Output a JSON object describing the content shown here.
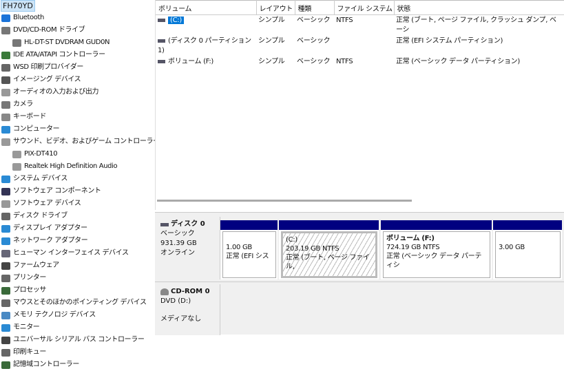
{
  "tree": {
    "root": "FH70YD",
    "items": [
      {
        "label": "Bluetooth",
        "icon": "bluetooth-icon",
        "color": "#1a73d9",
        "indent": 0
      },
      {
        "label": "DVD/CD-ROM ドライブ",
        "icon": "dvd-drive-icon",
        "color": "#777",
        "indent": 0
      },
      {
        "label": "HL-DT-ST DVDRAM GUD0N",
        "icon": "dvd-drive-icon",
        "color": "#777",
        "indent": 1
      },
      {
        "label": "IDE ATA/ATAPI コントローラー",
        "icon": "ide-controller-icon",
        "color": "#3a7a3a",
        "indent": 0
      },
      {
        "label": "WSD 印刷プロバイダー",
        "icon": "printer-icon",
        "color": "#666",
        "indent": 0
      },
      {
        "label": "イメージング デバイス",
        "icon": "imaging-device-icon",
        "color": "#555",
        "indent": 0
      },
      {
        "label": "オーディオの入力および出力",
        "icon": "speaker-icon",
        "color": "#999",
        "indent": 0
      },
      {
        "label": "カメラ",
        "icon": "camera-icon",
        "color": "#777",
        "indent": 0
      },
      {
        "label": "キーボード",
        "icon": "keyboard-icon",
        "color": "#888",
        "indent": 0
      },
      {
        "label": "コンピューター",
        "icon": "computer-icon",
        "color": "#2a8ad4",
        "indent": 0
      },
      {
        "label": "サウンド、ビデオ、およびゲーム コントローラー",
        "icon": "speaker-icon",
        "color": "#999",
        "indent": 0
      },
      {
        "label": "PIX-DT410",
        "icon": "speaker-icon",
        "color": "#999",
        "indent": 1
      },
      {
        "label": "Realtek High Definition Audio",
        "icon": "speaker-icon",
        "color": "#999",
        "indent": 1
      },
      {
        "label": "システム デバイス",
        "icon": "system-device-icon",
        "color": "#2a8ad4",
        "indent": 0
      },
      {
        "label": "ソフトウェア コンポーネント",
        "icon": "software-component-icon",
        "color": "#335",
        "indent": 0
      },
      {
        "label": "ソフトウェア デバイス",
        "icon": "software-device-icon",
        "color": "#999",
        "indent": 0
      },
      {
        "label": "ディスク ドライブ",
        "icon": "disk-drive-icon",
        "color": "#666",
        "indent": 0
      },
      {
        "label": "ディスプレイ アダプター",
        "icon": "display-adapter-icon",
        "color": "#2a8ad4",
        "indent": 0
      },
      {
        "label": "ネットワーク アダプター",
        "icon": "network-adapter-icon",
        "color": "#2a8ad4",
        "indent": 0
      },
      {
        "label": "ヒューマン インターフェイス デバイス",
        "icon": "hid-icon",
        "color": "#667",
        "indent": 0
      },
      {
        "label": "ファームウェア",
        "icon": "firmware-icon",
        "color": "#444",
        "indent": 0
      },
      {
        "label": "プリンター",
        "icon": "printer-icon",
        "color": "#666",
        "indent": 0
      },
      {
        "label": "プロセッサ",
        "icon": "processor-icon",
        "color": "#3a6a3a",
        "indent": 0
      },
      {
        "label": "マウスとそのほかのポインティング デバイス",
        "icon": "mouse-icon",
        "color": "#666",
        "indent": 0
      },
      {
        "label": "メモリ テクノロジ デバイス",
        "icon": "memory-device-icon",
        "color": "#4a8ac4",
        "indent": 0
      },
      {
        "label": "モニター",
        "icon": "monitor-icon",
        "color": "#2a8ad4",
        "indent": 0
      },
      {
        "label": "ユニバーサル シリアル バス コントローラー",
        "icon": "usb-icon",
        "color": "#444",
        "indent": 0
      },
      {
        "label": "印刷キュー",
        "icon": "print-queue-icon",
        "color": "#666",
        "indent": 0
      },
      {
        "label": "記憶域コントローラー",
        "icon": "storage-controller-icon",
        "color": "#3a6a3a",
        "indent": 0
      }
    ]
  },
  "volumes": {
    "headers": [
      "ボリューム",
      "レイアウト",
      "種類",
      "ファイル システム",
      "状態"
    ],
    "rows": [
      [
        "(C:)",
        "シンプル",
        "ベーシック",
        "NTFS",
        "正常 (ブート, ページ ファイル, クラッシュ ダンプ, ベーシ"
      ],
      [
        "(ディスク 0 パーティション 1)",
        "シンプル",
        "ベーシック",
        "",
        "正常 (EFI システム パーティション)"
      ],
      [
        "ボリューム (F:)",
        "シンプル",
        "ベーシック",
        "NTFS",
        "正常 (ベーシック データ パーティション)"
      ]
    ]
  },
  "disks": [
    {
      "name": "ディスク 0",
      "type": "ベーシック",
      "size": "931.39 GB",
      "status": "オンライン",
      "partitions": [
        {
          "title": "",
          "size": "1.00 GB",
          "status": "正常 (EFI シス"
        },
        {
          "title": "(C:)",
          "size": "203.19 GB NTFS",
          "status": "正常 (ブート, ページ ファイル,"
        },
        {
          "title": "ボリューム (F:)",
          "size": "724.19 GB NTFS",
          "status": "正常 (ベーシック データ パーティシ"
        },
        {
          "title": "",
          "size": "3.00 GB",
          "status": ""
        }
      ]
    },
    {
      "name": "CD-ROM 0",
      "type": "DVD (D:)",
      "size": "",
      "status": "メディアなし"
    }
  ],
  "colors": {
    "partition_bar": "#000080",
    "selection": "#0078d7"
  }
}
